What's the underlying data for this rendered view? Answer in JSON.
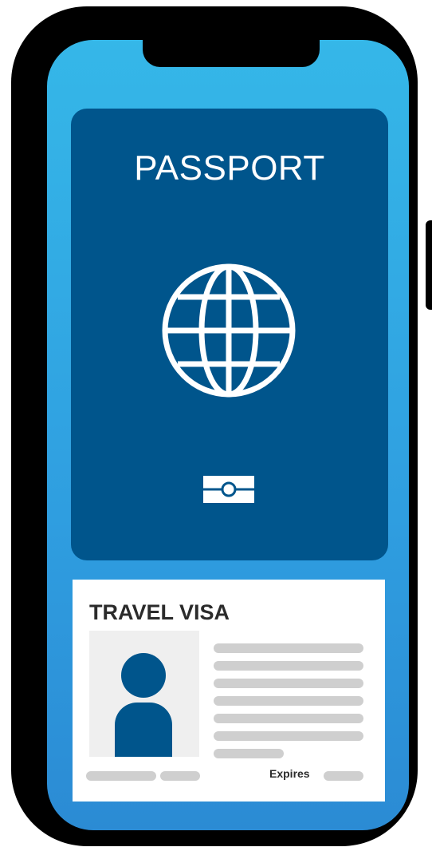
{
  "passport": {
    "title": "PASSPORT",
    "globe_icon": "globe-icon",
    "chip_icon": "biometric-chip-icon"
  },
  "visa": {
    "title": "TRAVEL VISA",
    "photo_icon": "person-avatar-icon",
    "expires_label": "Expires"
  },
  "colors": {
    "screen_top": "#35b7e8",
    "screen_bottom": "#2b8bd4",
    "passport_blue": "#00558c",
    "placeholder_gray": "#cfcfcf",
    "phone_frame": "#000000"
  }
}
